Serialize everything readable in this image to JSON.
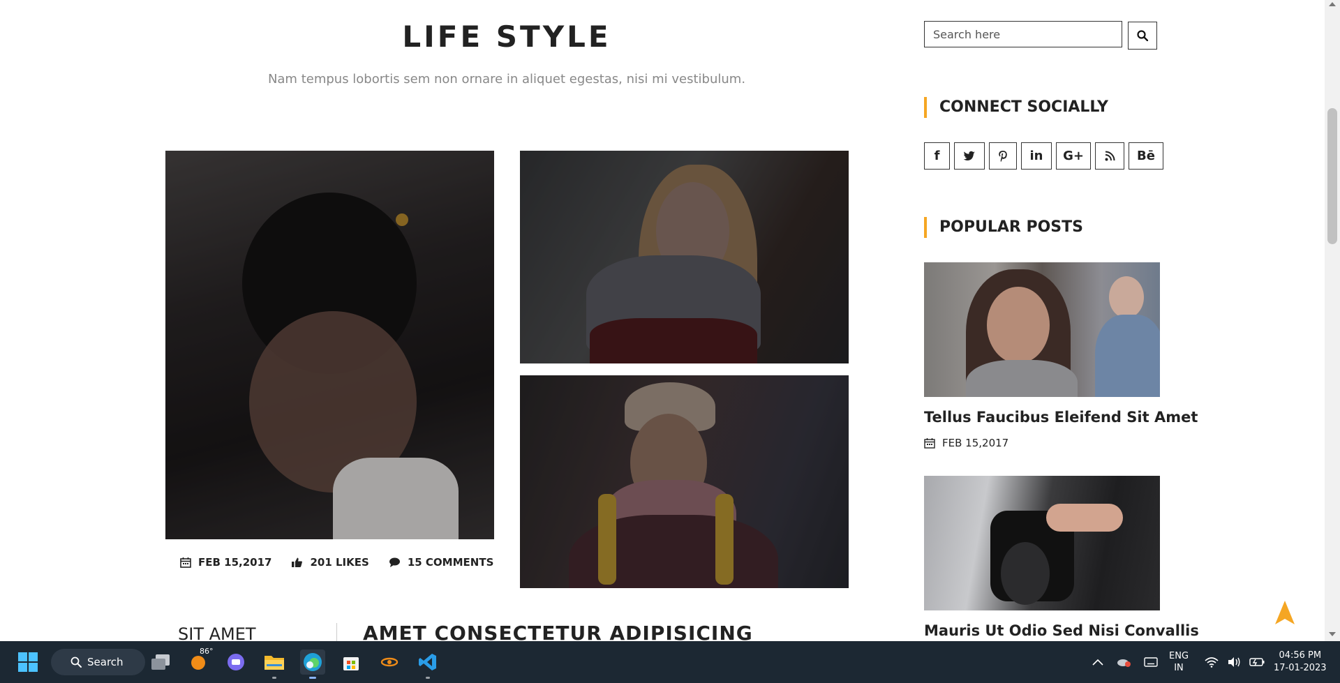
{
  "section": {
    "title": "LIFE STYLE",
    "subtitle": "Nam tempus lobortis sem non ornare in aliquet egestas, nisi mi vestibulum."
  },
  "post_meta": {
    "date": "FEB 15,2017",
    "likes": "201 LIKES",
    "comments": "15 COMMENTS"
  },
  "lower": {
    "left_label": "SIT AMET",
    "title": "AMET CONSECTETUR ADIPISICING"
  },
  "sidebar": {
    "search_placeholder": "Search here",
    "connect_title": "CONNECT SOCIALLY",
    "social": [
      {
        "label": "f",
        "icon": "facebook-icon"
      },
      {
        "label": "twitter",
        "icon": "twitter-icon"
      },
      {
        "label": "P",
        "icon": "pinterest-icon"
      },
      {
        "label": "in",
        "icon": "linkedin-icon"
      },
      {
        "label": "G+",
        "icon": "google-plus-icon"
      },
      {
        "label": "rss",
        "icon": "rss-icon"
      },
      {
        "label": "Bē",
        "icon": "behance-icon"
      }
    ],
    "popular_title": "POPULAR POSTS",
    "popular_posts": [
      {
        "title": "Tellus Faucibus Eleifend Sit Amet",
        "date": "FEB 15,2017"
      },
      {
        "title": "Mauris Ut Odio Sed Nisi Convallis"
      }
    ]
  },
  "taskbar": {
    "search_label": "Search",
    "weather_temp": "86°",
    "lang_top": "ENG",
    "lang_bottom": "IN",
    "time": "04:56 PM",
    "date": "17-01-2023"
  },
  "colors": {
    "accent": "#f5a623",
    "taskbar": "#1c2833",
    "text": "#222222"
  }
}
